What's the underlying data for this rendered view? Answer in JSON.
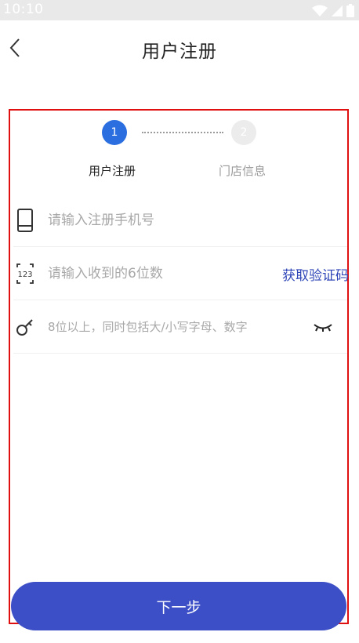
{
  "status_bar": {
    "time": "10:10"
  },
  "nav": {
    "title": "用户注册"
  },
  "stepper": {
    "steps": [
      {
        "number": "1",
        "label": "用户注册",
        "active": true
      },
      {
        "number": "2",
        "label": "门店信息",
        "active": false
      }
    ]
  },
  "form": {
    "phone": {
      "placeholder": "请输入注册手机号",
      "icon": "phone-icon"
    },
    "code": {
      "placeholder": "请输入收到的6位数",
      "icon": "code-123-icon",
      "action_label": "获取验证码"
    },
    "password": {
      "placeholder": "8位以上，同时包括大/小写字母、数字",
      "icon": "key-icon",
      "toggle_icon": "eye-closed-icon"
    }
  },
  "actions": {
    "next_label": "下一步"
  },
  "colors": {
    "primary": "#3c4fc6",
    "step_active": "#2a6ee0",
    "link": "#2f46b8",
    "highlight_border": "#e01010"
  }
}
